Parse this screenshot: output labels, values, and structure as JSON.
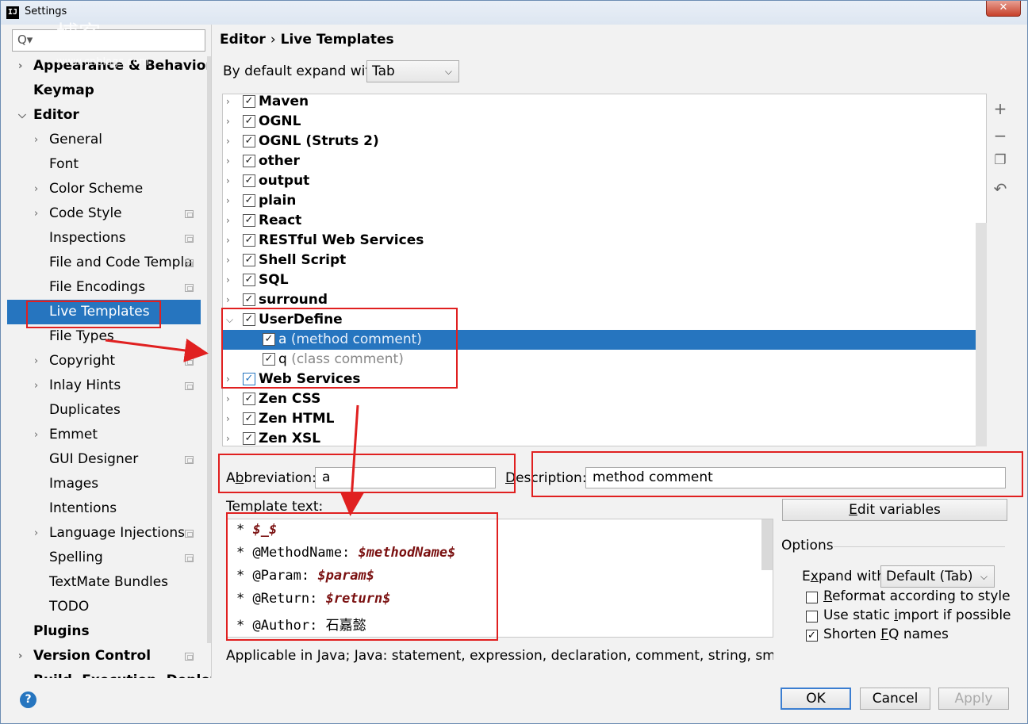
{
  "window": {
    "title": "Settings",
    "close_label": "✕",
    "app_icon_label": "IJ"
  },
  "watermark": {
    "text": "博客",
    "sub": "www.cnblogs.com"
  },
  "sidebar": {
    "search_placeholder": "Q▾",
    "items": [
      {
        "label": "Appearance & Behavior",
        "level": 0,
        "expandable": true,
        "bold": true
      },
      {
        "label": "Keymap",
        "level": 0,
        "expandable": false,
        "bold": true
      },
      {
        "label": "Editor",
        "level": 0,
        "expandable": true,
        "expanded": true,
        "bold": true
      },
      {
        "label": "General",
        "level": 1,
        "expandable": true
      },
      {
        "label": "Font",
        "level": 1,
        "expandable": false
      },
      {
        "label": "Color Scheme",
        "level": 1,
        "expandable": true
      },
      {
        "label": "Code Style",
        "level": 1,
        "expandable": true,
        "copy": true
      },
      {
        "label": "Inspections",
        "level": 1,
        "expandable": false,
        "copy": true
      },
      {
        "label": "File and Code Templa",
        "level": 1,
        "expandable": false,
        "copy": true
      },
      {
        "label": "File Encodings",
        "level": 1,
        "expandable": false,
        "copy": true
      },
      {
        "label": "Live Templates",
        "level": 1,
        "expandable": false,
        "selected": true
      },
      {
        "label": "File Types",
        "level": 1,
        "expandable": false
      },
      {
        "label": "Copyright",
        "level": 1,
        "expandable": true,
        "copy": true
      },
      {
        "label": "Inlay Hints",
        "level": 1,
        "expandable": true,
        "copy": true
      },
      {
        "label": "Duplicates",
        "level": 1,
        "expandable": false
      },
      {
        "label": "Emmet",
        "level": 1,
        "expandable": true
      },
      {
        "label": "GUI Designer",
        "level": 1,
        "expandable": false,
        "copy": true
      },
      {
        "label": "Images",
        "level": 1,
        "expandable": false
      },
      {
        "label": "Intentions",
        "level": 1,
        "expandable": false
      },
      {
        "label": "Language Injections",
        "level": 1,
        "expandable": true,
        "copy": true
      },
      {
        "label": "Spelling",
        "level": 1,
        "expandable": false,
        "copy": true
      },
      {
        "label": "TextMate Bundles",
        "level": 1,
        "expandable": false
      },
      {
        "label": "TODO",
        "level": 1,
        "expandable": false
      },
      {
        "label": "Plugins",
        "level": 0,
        "expandable": false,
        "bold": true
      },
      {
        "label": "Version Control",
        "level": 0,
        "expandable": true,
        "bold": true,
        "copy": true
      },
      {
        "label": "Build, Execution, Deployment",
        "level": 0,
        "expandable": true,
        "bold": true
      }
    ]
  },
  "breadcrumb": {
    "parent": "Editor",
    "sep": "›",
    "current": "Live Templates"
  },
  "expand_default": {
    "label": "By default expand with",
    "value": "Tab"
  },
  "tree": {
    "rows": [
      {
        "label": "Maven",
        "group": true,
        "checked": true
      },
      {
        "label": "OGNL",
        "group": true,
        "checked": true
      },
      {
        "label": "OGNL (Struts 2)",
        "group": true,
        "checked": true
      },
      {
        "label": "other",
        "group": true,
        "checked": true
      },
      {
        "label": "output",
        "group": true,
        "checked": true
      },
      {
        "label": "plain",
        "group": true,
        "checked": true
      },
      {
        "label": "React",
        "group": true,
        "checked": true
      },
      {
        "label": "RESTful Web Services",
        "group": true,
        "checked": true
      },
      {
        "label": "Shell Script",
        "group": true,
        "checked": true
      },
      {
        "label": "SQL",
        "group": true,
        "checked": true
      },
      {
        "label": "surround",
        "group": true,
        "checked": true
      },
      {
        "label": "UserDefine",
        "group": true,
        "checked": true,
        "expanded": true
      },
      {
        "label": "a",
        "desc": "(method comment)",
        "group": false,
        "checked": true,
        "selected": true
      },
      {
        "label": "q",
        "desc": "(class comment)",
        "group": false,
        "checked": true
      },
      {
        "label": "Web Services",
        "group": true,
        "checked": true,
        "blue": true
      },
      {
        "label": "Zen CSS",
        "group": true,
        "checked": true
      },
      {
        "label": "Zen HTML",
        "group": true,
        "checked": true
      },
      {
        "label": "Zen XSL",
        "group": true,
        "checked": true
      }
    ]
  },
  "toolbar": {
    "add": "+",
    "remove": "−",
    "copy": "❐",
    "revert": "↶"
  },
  "abbreviation": {
    "label_pre": "A",
    "label_u": "b",
    "label_post": "breviation:",
    "value": "a"
  },
  "description": {
    "label_pre": "",
    "label_u": "D",
    "label_post": "escription:",
    "value": "method comment"
  },
  "template_text": {
    "label": "Template text:",
    "lines": [
      [
        {
          "t": "* "
        },
        {
          "t": "$_$",
          "v": true
        }
      ],
      [
        {
          "t": "* @MethodName: "
        },
        {
          "t": "$methodName$",
          "v": true
        }
      ],
      [
        {
          "t": "* @Param: "
        },
        {
          "t": "$param$",
          "v": true
        }
      ],
      [
        {
          "t": "* @Return: "
        },
        {
          "t": "$return$",
          "v": true
        }
      ],
      [
        {
          "t": "* @Author: 石嘉懿"
        }
      ]
    ]
  },
  "applicable": "Applicable in Java; Java: statement, expression, declaration, comment, string, smart type co",
  "edit_variables": {
    "pre": "",
    "u": "E",
    "post": "dit variables"
  },
  "options": {
    "title": "Options",
    "expand_label_pre": "E",
    "expand_label_u": "x",
    "expand_label_post": "pand with",
    "expand_value": "Default (Tab)",
    "checkboxes": [
      {
        "pre": "",
        "u": "R",
        "post": "eformat according to style",
        "checked": false
      },
      {
        "pre": "Use static ",
        "u": "i",
        "post": "mport if possible",
        "checked": false
      },
      {
        "pre": "Shorten ",
        "u": "F",
        "post": "Q names",
        "checked": true
      }
    ]
  },
  "buttons": {
    "ok": "OK",
    "cancel": "Cancel",
    "apply": "Apply"
  },
  "colors": {
    "selection": "#2675bf",
    "annotation_red": "#e02020",
    "template_var": "#7a1010"
  }
}
